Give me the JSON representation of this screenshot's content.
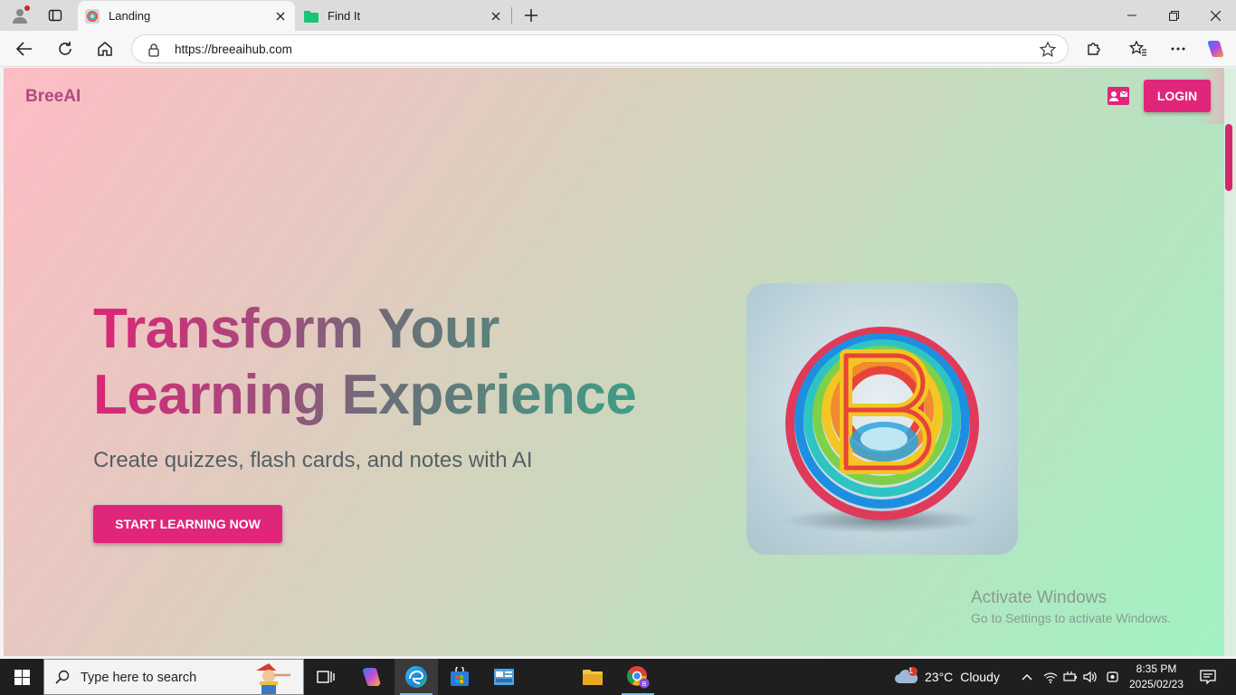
{
  "browser": {
    "tabs": [
      {
        "title": "Landing",
        "active": true
      },
      {
        "title": "Find It",
        "active": false
      }
    ],
    "url": "https://breeaihub.com"
  },
  "page": {
    "brand": "BreeAI",
    "login_label": "LOGIN",
    "hero": {
      "title_line1": "Transform Your",
      "title_line2": "Learning Experience",
      "subtitle": "Create quizzes, flash cards, and notes with AI",
      "cta_label": "START LEARNING NOW"
    },
    "accent_color": "#e0267a"
  },
  "watermark": {
    "line1": "Activate Windows",
    "line2": "Go to Settings to activate Windows."
  },
  "taskbar": {
    "search_placeholder": "Type here to search",
    "weather": {
      "temp": "23°C",
      "condition": "Cloudy",
      "badge": "1"
    },
    "time": "8:35 PM",
    "date": "2025/02/23"
  }
}
